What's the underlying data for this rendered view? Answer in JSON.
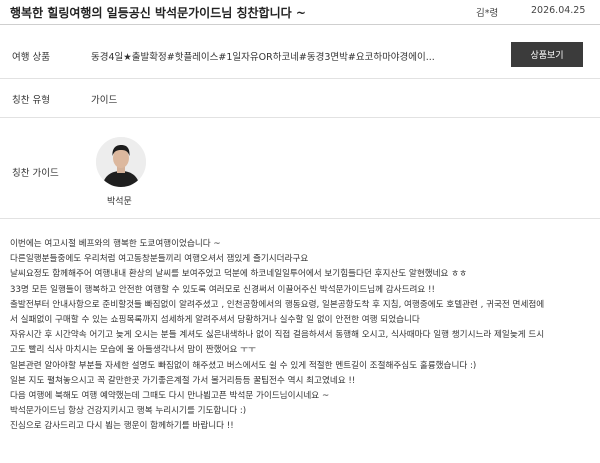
{
  "header": {
    "title": "행복한 힐링여행의 일등공신 박석문가이드님 칭찬합니다 ~",
    "author": "김*령",
    "date": "2026.04.25"
  },
  "product": {
    "label": "여행 상품",
    "value": "동경4일★출발확정#핫플레이스#1일자유OR하코네#동경3면박#요코하마야경에이...",
    "button_label": "상품보기"
  },
  "praise_type": {
    "label": "칭찬 유형",
    "value": "가이드"
  },
  "praise_guide": {
    "label": "칭찬 가이드",
    "name": "박석문",
    "avatar_icon": "person-photo"
  },
  "body_lines": [
    "이번에는 여고시절 베프와의 행복한 도쿄여행이었습니다 ~",
    "다른일행분들중에도 우리처럼 여고동창분들끼리 여행오셔서 잼있게 즐기시더라구요",
    "날씨요정도 함께해주어 여행내내 환상의 날씨를 보여주었고 덕분에 하코네일일투어에서 보기힘들다던 후지산도 알현했네요 ㅎㅎ",
    "33명 모든 일행들이 행복하고 안전한 여행할 수 있도록 여러모로 신경써서 이끌어주신 박석문가이드님께 감사드려요 !!",
    "출발전부터 안내사항으로 준비할것들 빠짐없이 알려주셨고 , 인천공항에서의 행동요령, 일본공항도착 후 지침, 여행중에도 호텔관련 , 귀국전 면세점에",
    "서 실패없이 구매할 수 있는 쇼핑목록까지 섬세하게 알려주셔서 당황하거나 실수할 일 없이 안전한 여행 되었습니다",
    "자유시간 후 시간약속 어기고 늦게 오시는 분들 계셔도 싫은내색하나 없이 직접 걸음하셔서 동행해 오시고, 식사때마다 일행 챙기시느라 제일늦게 드시",
    "고도 빨리 식사 마치시는 모습에 울 아들생각나서 맘이 짠했어요 ㅜㅜ",
    "일본관련 알아야할 부분들 자세한 설명도 빠짐없이 해주셨고 버스에서도 쉴 수 있게 적절한 멘트길이 조절해주심도 훌륭했습니다 :)",
    "일본 지도 펼쳐놓으시고 꼭 갈만한곳 가기좋은계절 가서 볼거리등등 꿀팁전수 역시 최고였네요 !!",
    "다음 여행에 북해도 여행 예약했는데 그때도 다시 만나뵙고픈 박석문 가이드님이시네요 ~",
    "박석문가이드님 항상 건강지키시고 행복 누리시기를 기도합니다 :)",
    "진심으로 감사드리고 다시 뵙는 행운이 함께하기를 바랍니다 !!"
  ],
  "colors": {
    "button_bg": "#3b3b3b",
    "divider": "#e2e2e2",
    "text": "#333333"
  }
}
